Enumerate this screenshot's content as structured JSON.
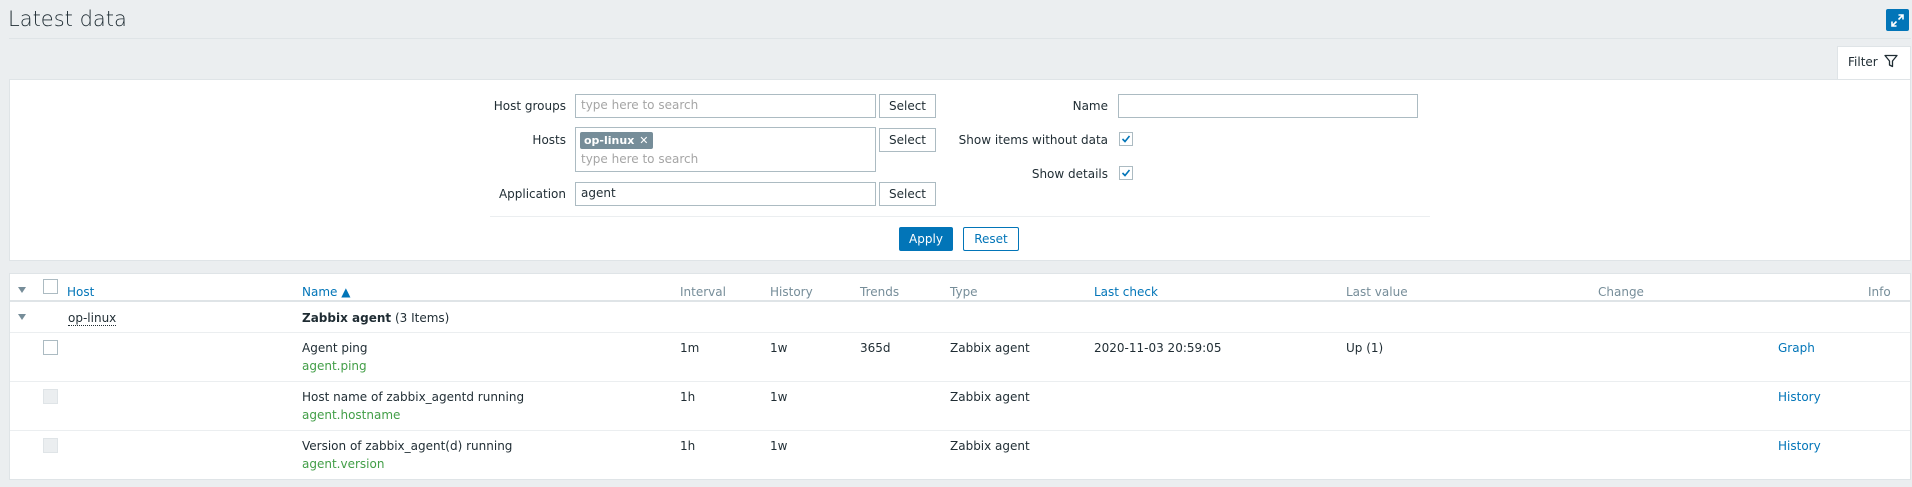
{
  "header": {
    "title": "Latest data"
  },
  "filter": {
    "tab_label": "Filter",
    "host_groups": {
      "label": "Host groups",
      "placeholder": "type here to search",
      "select_label": "Select"
    },
    "hosts": {
      "label": "Hosts",
      "chip": "op-linux",
      "placeholder": "type here to search",
      "select_label": "Select"
    },
    "application": {
      "label": "Application",
      "value": "agent",
      "select_label": "Select"
    },
    "name": {
      "label": "Name",
      "value": ""
    },
    "show_items_without_data": {
      "label": "Show items without data",
      "checked": true
    },
    "show_details": {
      "label": "Show details",
      "checked": true
    },
    "apply_label": "Apply",
    "reset_label": "Reset"
  },
  "table": {
    "columns": {
      "host": "Host",
      "name": "Name ▲",
      "interval": "Interval",
      "history": "History",
      "trends": "Trends",
      "type": "Type",
      "last_check": "Last check",
      "last_value": "Last value",
      "change": "Change",
      "info": "Info"
    },
    "group": {
      "host": "op-linux",
      "app": "Zabbix agent",
      "count": "(3 Items)"
    },
    "rows": [
      {
        "name": "Agent ping",
        "key": "agent.ping",
        "interval": "1m",
        "history": "1w",
        "trends": "365d",
        "type": "Zabbix agent",
        "last_check": "2020-11-03 20:59:05",
        "last_value": "Up (1)",
        "change": "",
        "action": "Graph"
      },
      {
        "name": "Host name of zabbix_agentd running",
        "key": "agent.hostname",
        "interval": "1h",
        "history": "1w",
        "trends": "",
        "type": "Zabbix agent",
        "last_check": "",
        "last_value": "",
        "change": "",
        "action": "History"
      },
      {
        "name": "Version of zabbix_agent(d) running",
        "key": "agent.version",
        "interval": "1h",
        "history": "1w",
        "trends": "",
        "type": "Zabbix agent",
        "last_check": "",
        "last_value": "",
        "change": "",
        "action": "History"
      }
    ]
  }
}
